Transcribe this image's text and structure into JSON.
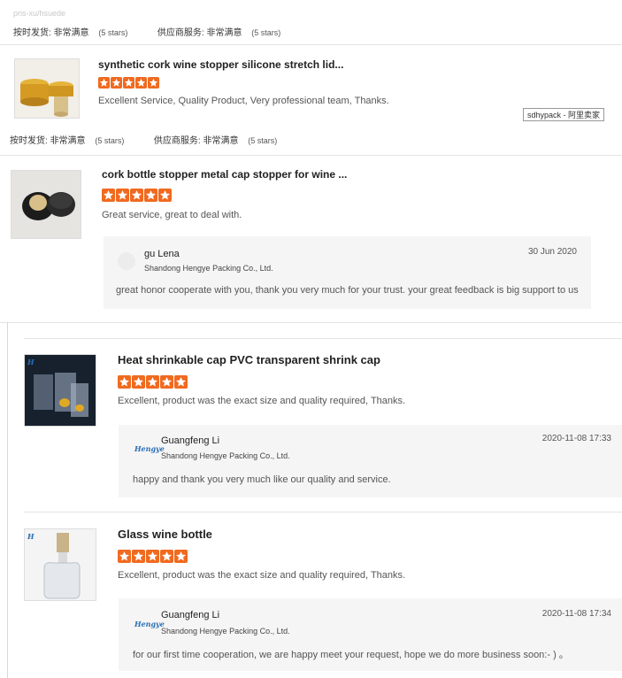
{
  "blurred_user": "pris-xu/hsuede",
  "ratings": {
    "delivery_label": "按时发货:",
    "delivery_value": "非常满意",
    "delivery_stars": "(5 stars)",
    "service_label": "供应商服务:",
    "service_value": "非常满意",
    "service_stars": "(5 stars)"
  },
  "seller_tag": "sdhypack - 阿里卖家",
  "reviews": [
    {
      "title": "synthetic cork wine stopper silicone stretch lid...",
      "stars": 5,
      "comment": "Excellent Service, Quality Product, Very professional team, Thanks."
    },
    {
      "title": "cork bottle stopper metal cap stopper for wine ...",
      "stars": 5,
      "comment": "Great service, great to deal with.",
      "reply": {
        "name": "gu Lena",
        "company": "Shandong Hengye Packing Co., Ltd.",
        "date": "30 Jun 2020",
        "text": "great honor cooperate with you, thank you very much for your trust. your great feedback is big support to us"
      }
    },
    {
      "title": "Heat shrinkable cap PVC transparent shrink cap",
      "stars": 5,
      "comment": "Excellent, product was the exact size and quality required, Thanks.",
      "reply": {
        "name": "Guangfeng Li",
        "company": "Shandong Hengye Packing Co., Ltd.",
        "date": "2020-11-08 17:33",
        "text": "happy and thank you very much like our quality and service."
      }
    },
    {
      "title": "Glass wine bottle",
      "stars": 5,
      "comment": "Excellent, product was the exact size and quality required, Thanks.",
      "reply": {
        "name": "Guangfeng Li",
        "company": "Shandong Hengye Packing Co., Ltd.",
        "date": "2020-11-08 17:34",
        "text": "for our first time cooperation, we are happy meet your request, hope we do more business soon:- ) 。"
      }
    }
  ],
  "logo_text": "Hengye",
  "colors": {
    "star": "#f06a1f",
    "reply_bg": "#f5f5f5",
    "divider": "#e4e4e4"
  }
}
